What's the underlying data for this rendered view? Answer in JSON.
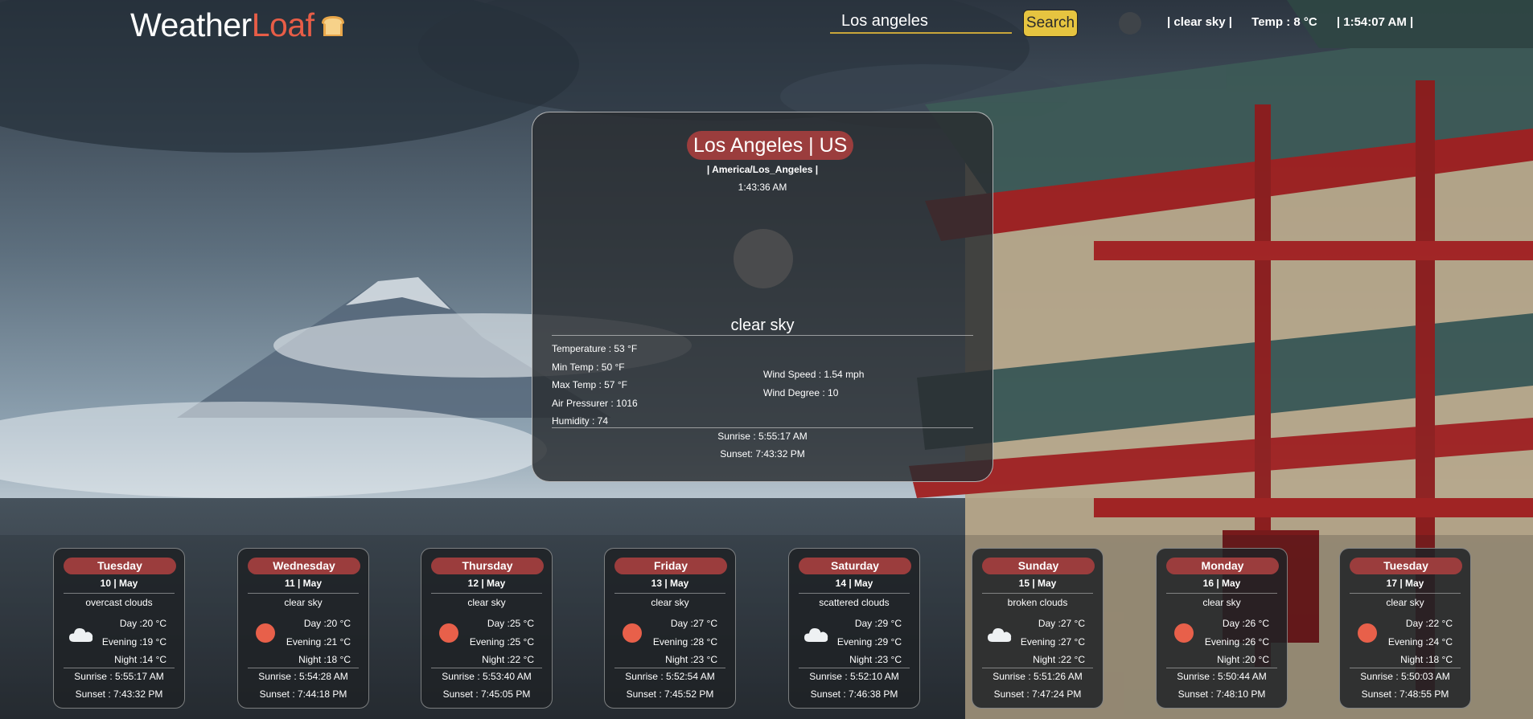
{
  "header": {
    "logo_part1": "Weather",
    "logo_part2": "Loaf",
    "search_value": "Los angeles",
    "search_label": "Search",
    "status_desc": "| clear sky |",
    "status_temp": "Temp : 8 °C",
    "status_time": "| 1:54:07 AM |"
  },
  "main": {
    "city": "Los Angeles | US",
    "timezone": "| America/Los_Angeles |",
    "local_time": "1:43:36 AM",
    "description": "clear sky",
    "temperature": "Temperature : 53 °F",
    "min_temp": "Min Temp : 50 °F",
    "max_temp": "Max Temp : 57 °F",
    "pressure": "Air Pressurer : 1016",
    "humidity": "Humidity : 74",
    "wind_speed": "Wind Speed : 1.54 mph",
    "wind_degree": "Wind Degree : 10",
    "sunrise": "Sunrise : 5:55:17 AM",
    "sunset": "Sunset: 7:43:32 PM"
  },
  "forecast": [
    {
      "day": "Tuesday",
      "date": "10 | May",
      "desc": "overcast clouds",
      "icon": "cloud-icon",
      "day_t": "Day :20 °C",
      "evening_t": "Evening :19 °C",
      "night_t": "Night :14 °C",
      "sunrise": "Sunrise : 5:55:17 AM",
      "sunset": "Sunset : 7:43:32 PM"
    },
    {
      "day": "Wednesday",
      "date": "11 | May",
      "desc": "clear sky",
      "icon": "sun-icon",
      "day_t": "Day :20 °C",
      "evening_t": "Evening :21 °C",
      "night_t": "Night :18 °C",
      "sunrise": "Sunrise : 5:54:28 AM",
      "sunset": "Sunset : 7:44:18 PM"
    },
    {
      "day": "Thursday",
      "date": "12 | May",
      "desc": "clear sky",
      "icon": "sun-icon",
      "day_t": "Day :25 °C",
      "evening_t": "Evening :25 °C",
      "night_t": "Night :22 °C",
      "sunrise": "Sunrise : 5:53:40 AM",
      "sunset": "Sunset : 7:45:05 PM"
    },
    {
      "day": "Friday",
      "date": "13 | May",
      "desc": "clear sky",
      "icon": "sun-icon",
      "day_t": "Day :27 °C",
      "evening_t": "Evening :28 °C",
      "night_t": "Night :23 °C",
      "sunrise": "Sunrise : 5:52:54 AM",
      "sunset": "Sunset : 7:45:52 PM"
    },
    {
      "day": "Saturday",
      "date": "14 | May",
      "desc": "scattered clouds",
      "icon": "cloud-icon",
      "day_t": "Day :29 °C",
      "evening_t": "Evening :29 °C",
      "night_t": "Night :23 °C",
      "sunrise": "Sunrise : 5:52:10 AM",
      "sunset": "Sunset : 7:46:38 PM"
    },
    {
      "day": "Sunday",
      "date": "15 | May",
      "desc": "broken clouds",
      "icon": "cloud-icon",
      "day_t": "Day :27 °C",
      "evening_t": "Evening :27 °C",
      "night_t": "Night :22 °C",
      "sunrise": "Sunrise : 5:51:26 AM",
      "sunset": "Sunset : 7:47:24 PM"
    },
    {
      "day": "Monday",
      "date": "16 | May",
      "desc": "clear sky",
      "icon": "sun-icon",
      "day_t": "Day :26 °C",
      "evening_t": "Evening :26 °C",
      "night_t": "Night :20 °C",
      "sunrise": "Sunrise : 5:50:44 AM",
      "sunset": "Sunset : 7:48:10 PM"
    },
    {
      "day": "Tuesday",
      "date": "17 | May",
      "desc": "clear sky",
      "icon": "sun-icon",
      "day_t": "Day :22 °C",
      "evening_t": "Evening :24 °C",
      "night_t": "Night :18 °C",
      "sunrise": "Sunrise : 5:50:03 AM",
      "sunset": "Sunset : 7:48:55 PM"
    }
  ],
  "colors": {
    "accent_red": "#9b3d3d",
    "logo_red": "#e85d47",
    "search_yellow": "#e6c440",
    "sun_orange": "#e8604a"
  }
}
